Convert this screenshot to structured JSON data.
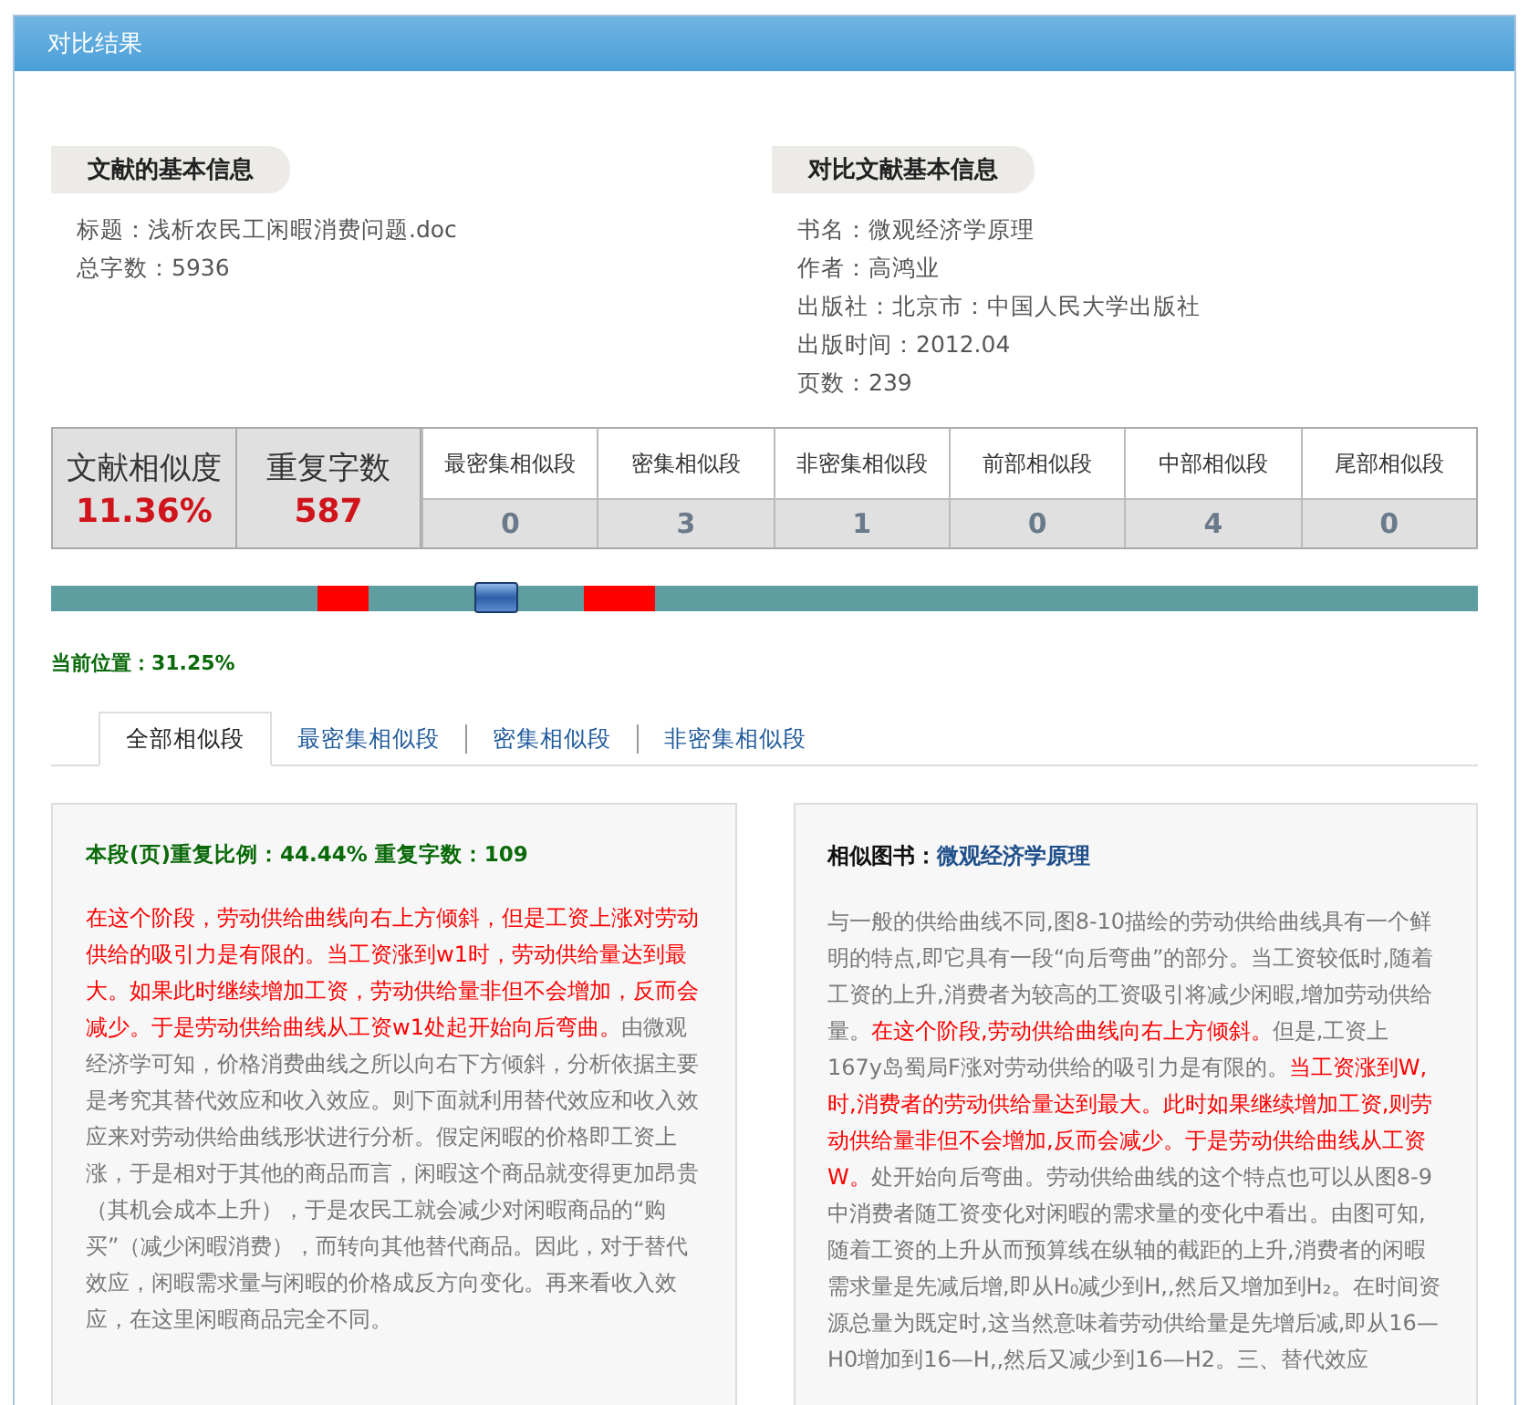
{
  "window": {
    "title": "对比结果"
  },
  "document_info": {
    "heading": "文献的基本信息",
    "lines": [
      "标题：浅析农民工闲暇消费问题.doc",
      "总字数：5936"
    ]
  },
  "compare_info": {
    "heading": "对比文献基本信息",
    "lines": [
      "书名：微观经济学原理",
      "作者：高鸿业",
      "出版社：北京市：中国人民大学出版社",
      "出版时间：2012.04",
      "页数：239"
    ]
  },
  "stats": {
    "similarity_label": "文献相似度",
    "similarity_value": "11.36%",
    "repeat_label": "重复字数",
    "repeat_value": "587",
    "columns": [
      {
        "label": "最密集相似段",
        "value": "0"
      },
      {
        "label": "密集相似段",
        "value": "3"
      },
      {
        "label": "非密集相似段",
        "value": "1"
      },
      {
        "label": "前部相似段",
        "value": "0"
      },
      {
        "label": "中部相似段",
        "value": "4"
      },
      {
        "label": "尾部相似段",
        "value": "0"
      }
    ]
  },
  "position_bar": {
    "level": 0.3125
  },
  "position_text": "当前位置：31.25%",
  "tabs": [
    {
      "label": "全部相似段",
      "selected": true
    },
    {
      "label": "最密集相似段",
      "selected": false
    },
    {
      "label": "密集相似段",
      "selected": false
    },
    {
      "label": "非密集相似段",
      "selected": false
    }
  ],
  "left_panel": {
    "ratio_text": "本段(页)重复比例：44.44%   重复字数：109",
    "segments": [
      {
        "text": "在这个阶段，劳动供给曲线向右上方倾斜，但是工资上涨对劳动供给的吸引力是有限的。当工资涨到w1时，劳动供给量达到最大。如果此时继续增加工资，劳动供给量非但不会增加，反而会减少。于是劳动供给曲线从工资w1处起开始向后弯曲。",
        "highlight": true
      },
      {
        "text": "由微观经济学可知，价格消费曲线之所以向右下方倾斜，分析依据主要是考究其替代效应和收入效应。则下面就利用替代效应和收入效应来对劳动供给曲线形状进行分析。假定闲暇的价格即工资上涨，于是相对于其他的商品而言，闲暇这个商品就变得更加昂贵（其机会成本上升），于是农民工就会减少对闲暇商品的“购买”（减少闲暇消费），而转向其他替代商品。因此，对于替代效应，闲暇需求量与闲暇的价格成反方向变化。再来看收入效应，在这里闲暇商品完全不同。",
        "highlight": false
      }
    ]
  },
  "right_panel": {
    "label": "相似图书：",
    "book": "微观经济学原理",
    "segments": [
      {
        "text": "与一般的供给曲线不同,图8-10描绘的劳动供给曲线具有一个鲜明的特点,即它具有一段“向后弯曲”的部分。当工资较低时,随着工资的上升,消费者为较高的工资吸引将减少闲暇,增加劳动供给量。",
        "highlight": false
      },
      {
        "text": "在这个阶段,劳动供给曲线向右上方倾斜。",
        "highlight": true
      },
      {
        "text": "但是,工资上167y岛蜀局F涨对劳动供给的吸引力是有限的。",
        "highlight": false
      },
      {
        "text": "当工资涨到W,时,消费者的劳动供给量达到最大。此时如果继续增加工资,则劳动供给量非但不会增加,反而会减少。于是劳动供给曲线从工资W。",
        "highlight": true
      },
      {
        "text": "处开始向后弯曲。劳动供给曲线的这个特点也可以从图8-9中消费者随工资变化对闲暇的需求量的变化中看出。由图可知,随着工资的上升从而预算线在纵轴的截距的上升,消费者的闲暇需求量是先减后增,即从H₀减少到H,,然后又增加到H₂。在时间资源总量为既定时,这当然意味着劳动供给量是先增后减,即从16—H0增加到16—H,,然后又减少到16—H2。三、替代效应",
        "highlight": false
      }
    ]
  }
}
